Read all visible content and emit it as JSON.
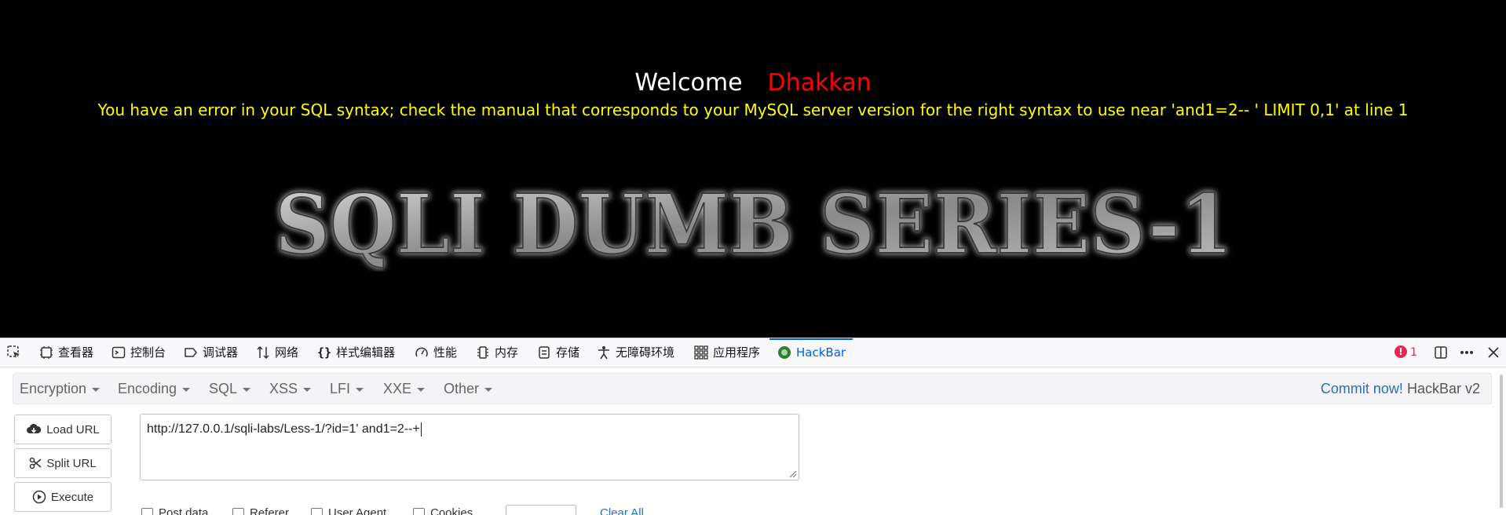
{
  "page": {
    "welcome_label": "Welcome",
    "user_name": "Dhakkan",
    "error_message": "You have an error in your SQL syntax; check the manual that corresponds to your MySQL server version for the right syntax to use near 'and1=2-- ' LIMIT 0,1' at line 1",
    "banner_text": "SQLI DUMB SERIES-1",
    "colors": {
      "welcome": "#ffffff",
      "user_name": "#ff0000",
      "error": "#ffff00",
      "background": "#000000"
    }
  },
  "devtools": {
    "tabs": [
      {
        "label": "查看器",
        "icon": "inspector-icon"
      },
      {
        "label": "控制台",
        "icon": "console-icon"
      },
      {
        "label": "调试器",
        "icon": "debugger-icon"
      },
      {
        "label": "网络",
        "icon": "network-icon"
      },
      {
        "label": "样式编辑器",
        "icon": "style-editor-icon"
      },
      {
        "label": "性能",
        "icon": "performance-icon"
      },
      {
        "label": "内存",
        "icon": "memory-icon"
      },
      {
        "label": "存储",
        "icon": "storage-icon"
      },
      {
        "label": "无障碍环境",
        "icon": "accessibility-icon"
      },
      {
        "label": "应用程序",
        "icon": "application-icon"
      },
      {
        "label": "HackBar",
        "icon": "hackbar-icon",
        "active": true
      }
    ],
    "error_count": "1",
    "accent": "#0061e0"
  },
  "hackbar": {
    "menus": [
      "Encryption",
      "Encoding",
      "SQL",
      "XSS",
      "LFI",
      "XXE",
      "Other"
    ],
    "commit_link": "Commit now!",
    "version": "HackBar v2",
    "buttons": {
      "load_url": "Load URL",
      "split_url": "Split URL",
      "execute": "Execute"
    },
    "url_value": "http://127.0.0.1/sqli-labs/Less-1/?id=1' and1=2--+",
    "options": [
      "Post data",
      "Referer",
      "User Agent",
      "Cookies"
    ],
    "clear_all": "Clear All"
  }
}
